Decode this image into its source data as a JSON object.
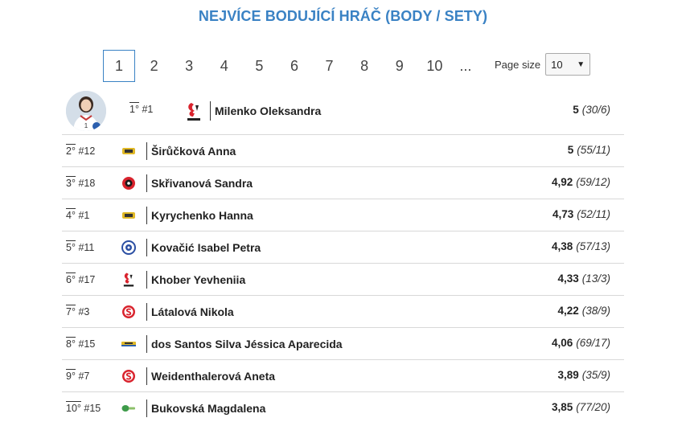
{
  "title": "NEJVÍCE BODUJÍCÍ HRÁČ (BODY / SETY)",
  "pagination": {
    "pages": [
      "1",
      "2",
      "3",
      "4",
      "5",
      "6",
      "7",
      "8",
      "9",
      "10"
    ],
    "active": "1",
    "ellipsis": "..."
  },
  "page_size": {
    "label": "Page size",
    "value": "10"
  },
  "colors": {
    "accent": "#3a82c4"
  },
  "players": [
    {
      "rank": "1°",
      "number": "#1",
      "name": "Milenko Oleksandra",
      "avg": "5",
      "detail": "(30/6)",
      "logo": "jp-logo"
    },
    {
      "rank": "2°",
      "number": "#12",
      "name": "Širůčková Anna",
      "avg": "5",
      "detail": "(55/11)",
      "logo": "yellow-team-logo"
    },
    {
      "rank": "3°",
      "number": "#18",
      "name": "Skřivanová Sandra",
      "avg": "4,92",
      "detail": "(59/12)",
      "logo": "red-black-team-logo"
    },
    {
      "rank": "4°",
      "number": "#1",
      "name": "Kyrychenko Hanna",
      "avg": "4,73",
      "detail": "(52/11)",
      "logo": "yellow-team-logo"
    },
    {
      "rank": "5°",
      "number": "#11",
      "name": "Kovačić Isabel Petra",
      "avg": "4,38",
      "detail": "(57/13)",
      "logo": "blue-team-logo"
    },
    {
      "rank": "6°",
      "number": "#17",
      "name": "Khober Yevheniia",
      "avg": "4,33",
      "detail": "(13/3)",
      "logo": "jp-logo"
    },
    {
      "rank": "7°",
      "number": "#3",
      "name": "Látalová Nikola",
      "avg": "4,22",
      "detail": "(38/9)",
      "logo": "red-s-team-logo"
    },
    {
      "rank": "8°",
      "number": "#15",
      "name": "dos Santos Silva Jéssica Aparecida",
      "avg": "4,06",
      "detail": "(69/17)",
      "logo": "yellow-blue-team-logo"
    },
    {
      "rank": "9°",
      "number": "#7",
      "name": "Weidenthalerová Aneta",
      "avg": "3,89",
      "detail": "(35/9)",
      "logo": "red-s-team-logo"
    },
    {
      "rank": "10°",
      "number": "#15",
      "name": "Bukovská Magdalena",
      "avg": "3,85",
      "detail": "(77/20)",
      "logo": "green-team-logo"
    }
  ]
}
